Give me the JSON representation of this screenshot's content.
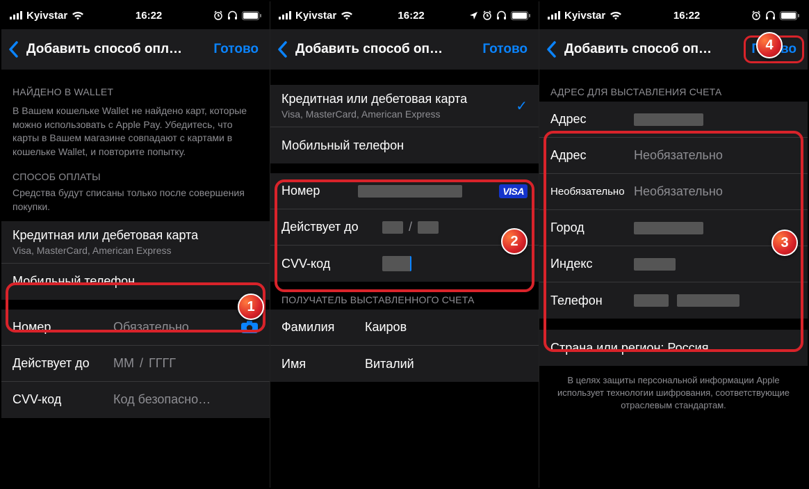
{
  "statusbar": {
    "carrier": "Kyivstar",
    "time": "16:22"
  },
  "nav": {
    "title_long": "Добавить способ опл…",
    "title_mid": "Добавить способ оп…",
    "done": "Готово"
  },
  "screen1": {
    "wallet_header": "НАЙДЕНО В WALLET",
    "wallet_desc": "В Вашем кошельке Wallet не найдено карт, которые можно использовать с Apple Pay. Убедитесь, что карты в Вашем магазине совпадают с картами в кошельке Wallet, и повторите попытку.",
    "method_header": "СПОСОБ ОПЛАТЫ",
    "method_desc": "Средства будут списаны только после совершения покупки.",
    "card_title": "Кредитная или дебетовая карта",
    "card_sub": "Visa, MasterCard, American Express",
    "mobile": "Мобильный телефон",
    "number": "Номер",
    "number_ph": "Обязательно",
    "expires": "Действует до",
    "mm": "ММ",
    "yyyy": "ГГГГ",
    "cvv": "CVV-код",
    "cvv_ph": "Код безопасно…"
  },
  "screen2": {
    "card_title": "Кредитная или дебетовая карта",
    "card_sub": "Visa, MasterCard, American Express",
    "mobile": "Мобильный телефон",
    "number": "Номер",
    "expires": "Действует до",
    "cvv": "CVV-код",
    "recipient_header": "ПОЛУЧАТЕЛЬ ВЫСТАВЛЕННОГО СЧЕТА",
    "lastname_label": "Фамилия",
    "lastname_value": "Каиров",
    "firstname_label": "Имя",
    "firstname_value": "Виталий",
    "visa": "VISA"
  },
  "screen3": {
    "billing_header": "АДРЕС ДЛЯ ВЫСТАВЛЕНИЯ СЧЕТА",
    "address": "Адрес",
    "optional": "Необязательно",
    "city": "Город",
    "zip": "Индекс",
    "phone": "Телефон",
    "country": "Страна или регион: Россия",
    "privacy": "В целях защиты персональной информации Apple использует технологии шифрования, соответствующие отраслевым стандартам."
  },
  "badges": {
    "n1": "1",
    "n2": "2",
    "n3": "3",
    "n4": "4"
  }
}
